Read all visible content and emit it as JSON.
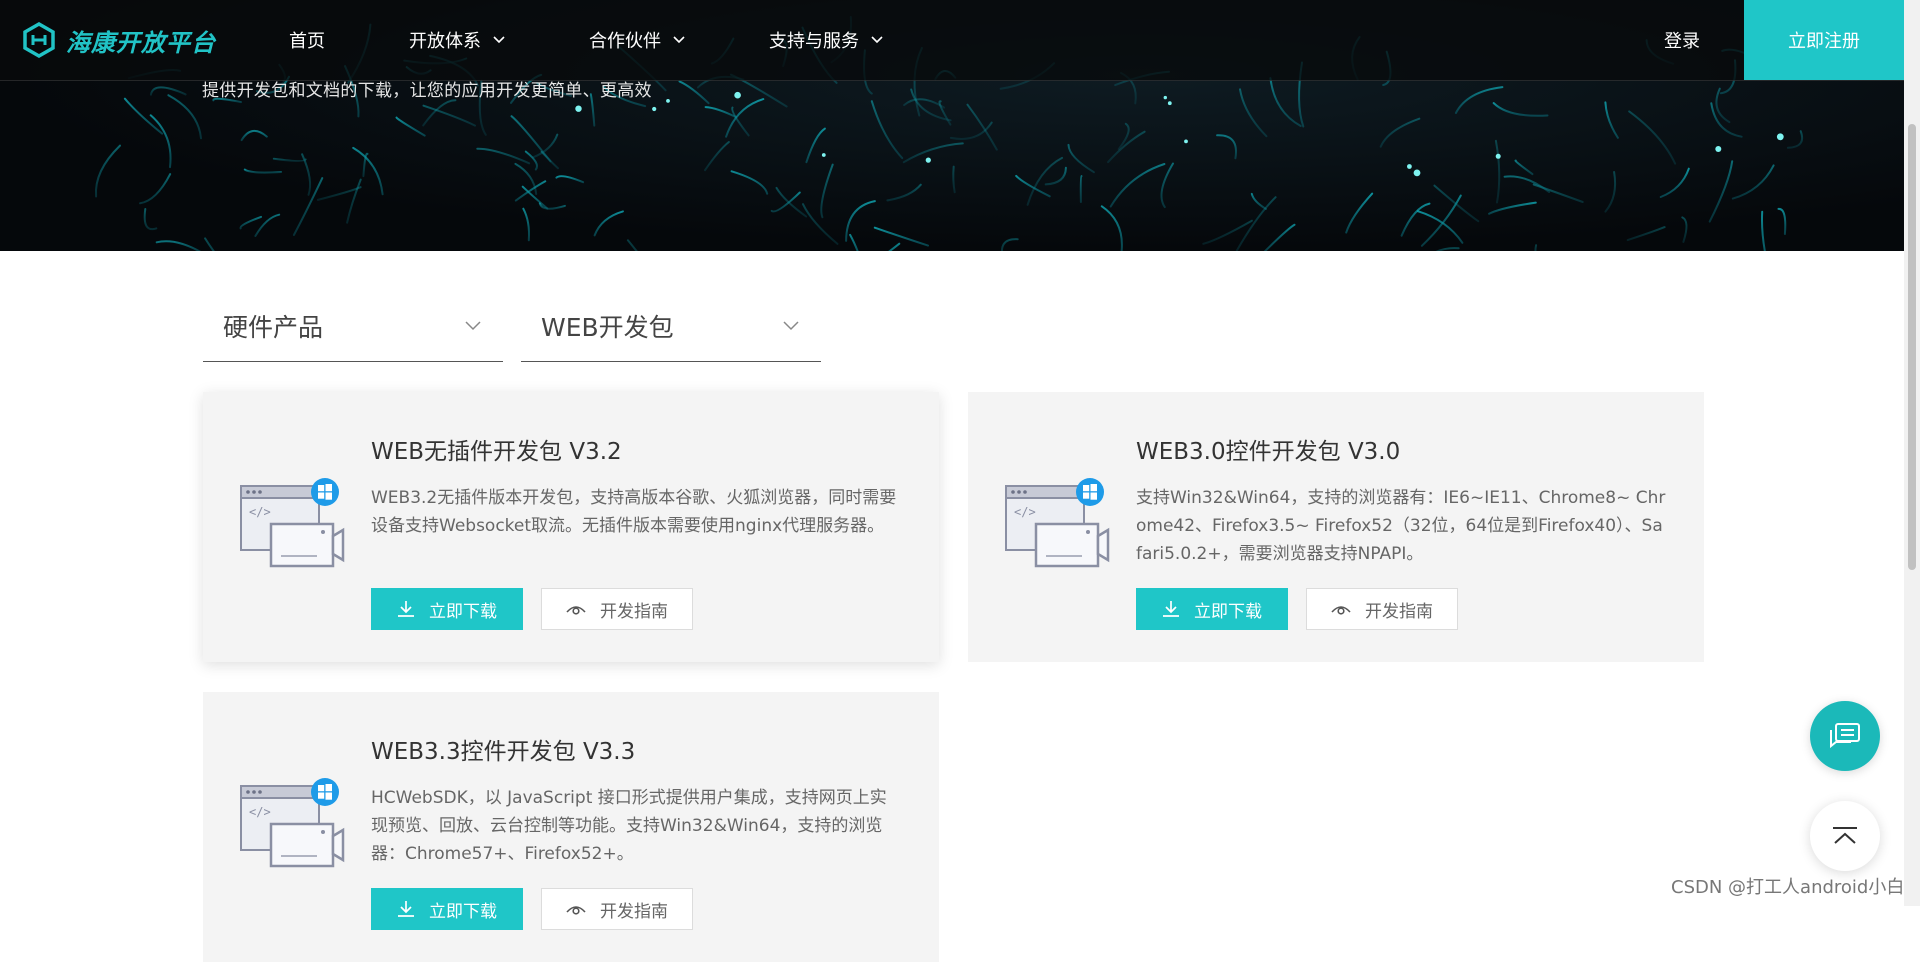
{
  "nav": {
    "logo_text": "海康开放平台",
    "items": [
      {
        "label": "首页",
        "has_dropdown": false
      },
      {
        "label": "开放体系",
        "has_dropdown": true
      },
      {
        "label": "合作伙伴",
        "has_dropdown": true
      },
      {
        "label": "支持与服务",
        "has_dropdown": true
      }
    ],
    "login_label": "登录",
    "register_label": "立即注册"
  },
  "hero": {
    "subtitle": "提供开发包和文档的下载，让您的应用开发更简单、更高效"
  },
  "filters": [
    {
      "label": "硬件产品"
    },
    {
      "label": "WEB开发包"
    }
  ],
  "cards": [
    {
      "title": "WEB无插件开发包 V3.2",
      "description": "WEB3.2无插件版本开发包，支持高版本谷歌、火狐浏览器，同时需要设备支持Websocket取流。无插件版本需要使用nginx代理服务器。",
      "download_label": "立即下载",
      "guide_label": "开发指南"
    },
    {
      "title": "WEB3.0控件开发包 V3.0",
      "description": "支持Win32&Win64，支持的浏览器有：IE6~IE11、Chrome8~ Chrome42、Firefox3.5~ Firefox52（32位，64位是到Firefox40）、Safari5.0.2+，需要浏览器支持NPAPI。",
      "download_label": "立即下载",
      "guide_label": "开发指南"
    },
    {
      "title": "WEB3.3控件开发包 V3.3",
      "description": "HCWebSDK，以 JavaScript 接口形式提供用户集成，支持网页上实现预览、回放、云台控制等功能。支持Win32&Win64，支持的浏览器：Chrome57+、Firefox52+。",
      "download_label": "立即下载",
      "guide_label": "开发指南"
    }
  ],
  "watermark": "CSDN @打工人android小白",
  "colors": {
    "accent": "#1fc6c8",
    "card_bg": "#f4f4f4",
    "windows_badge": "#1e9be8"
  },
  "icons": {
    "logo": "hikvision-logo-icon",
    "dropdown": "chevron-down-icon",
    "download": "download-icon",
    "guide": "eye-icon",
    "sdk": "browser-video-icon",
    "chat": "chat-icon",
    "back_to_top": "back-to-top-icon"
  }
}
